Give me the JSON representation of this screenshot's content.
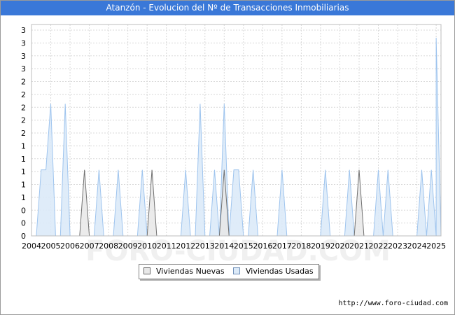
{
  "title": "Atanzón - Evolucion del Nº de Transacciones Inmobiliarias",
  "footer": "http://www.foro-ciudad.com",
  "watermark": "FORO-CIUDAD.COM",
  "colors": {
    "title_bg": "#3a78d8",
    "nuevas_fill": "#e8e8e8",
    "nuevas_line": "#707070",
    "usadas_fill": "#dceaf8",
    "usadas_line": "#9ec4ee",
    "grid": "#d8d8d8"
  },
  "chart_data": {
    "type": "area",
    "title": "Atanzón - Evolucion del Nº de Transacciones Inmobiliarias",
    "xlabel": "",
    "ylabel": "",
    "x_ticks": [
      "2004",
      "2005",
      "2006",
      "2007",
      "2008",
      "2009",
      "2010",
      "2011",
      "2012",
      "2013",
      "2014",
      "2015",
      "2016",
      "2017",
      "2018",
      "2019",
      "2020",
      "2021",
      "2022",
      "2023",
      "2024",
      "2025"
    ],
    "y_ticks": [
      "0",
      "0",
      "0",
      "1",
      "1",
      "1",
      "1",
      "1",
      "2",
      "2",
      "2",
      "2",
      "2",
      "3",
      "3",
      "3",
      "3"
    ],
    "ylim": [
      0,
      3.2
    ],
    "xlim": [
      2004,
      2025.25
    ],
    "grid": true,
    "legend_position": "bottom",
    "series": [
      {
        "name": "Viviendas Nuevas",
        "points": [
          [
            2006.5,
            0
          ],
          [
            2006.75,
            1
          ],
          [
            2007,
            0
          ],
          [
            2010,
            0
          ],
          [
            2010.25,
            1
          ],
          [
            2010.5,
            0
          ],
          [
            2013.75,
            0
          ],
          [
            2014,
            1
          ],
          [
            2014.25,
            0
          ],
          [
            2020.75,
            0
          ],
          [
            2021,
            1
          ],
          [
            2021.25,
            0
          ]
        ]
      },
      {
        "name": "Viviendas Usadas",
        "points": [
          [
            2004.25,
            0
          ],
          [
            2004.5,
            1
          ],
          [
            2004.75,
            1
          ],
          [
            2005,
            2
          ],
          [
            2005.25,
            0
          ],
          [
            2005.5,
            0
          ],
          [
            2005.75,
            2
          ],
          [
            2006,
            0
          ],
          [
            2007.25,
            0
          ],
          [
            2007.5,
            1
          ],
          [
            2007.75,
            0
          ],
          [
            2008.25,
            0
          ],
          [
            2008.5,
            1
          ],
          [
            2008.75,
            0
          ],
          [
            2009.5,
            0
          ],
          [
            2009.75,
            1
          ],
          [
            2010,
            0
          ],
          [
            2011.75,
            0
          ],
          [
            2012,
            1
          ],
          [
            2012.25,
            0
          ],
          [
            2012.5,
            0
          ],
          [
            2012.75,
            2
          ],
          [
            2013,
            0
          ],
          [
            2013.25,
            0
          ],
          [
            2013.5,
            1
          ],
          [
            2013.75,
            0
          ],
          [
            2014,
            2
          ],
          [
            2014.25,
            0
          ],
          [
            2014.5,
            1
          ],
          [
            2014.75,
            1
          ],
          [
            2015,
            0
          ],
          [
            2015.25,
            0
          ],
          [
            2015.5,
            1
          ],
          [
            2015.75,
            0
          ],
          [
            2016.75,
            0
          ],
          [
            2017,
            1
          ],
          [
            2017.25,
            0
          ],
          [
            2019,
            0
          ],
          [
            2019.25,
            1
          ],
          [
            2019.5,
            0
          ],
          [
            2020.25,
            0
          ],
          [
            2020.5,
            1
          ],
          [
            2020.75,
            0
          ],
          [
            2021.75,
            0
          ],
          [
            2022,
            1
          ],
          [
            2022.25,
            0
          ],
          [
            2022.5,
            1
          ],
          [
            2022.75,
            0
          ],
          [
            2024,
            0
          ],
          [
            2024.25,
            1
          ],
          [
            2024.5,
            0
          ],
          [
            2024.75,
            1
          ],
          [
            2025,
            0
          ],
          [
            2025,
            3
          ],
          [
            2025.25,
            0
          ]
        ]
      }
    ]
  },
  "legend": {
    "items": [
      {
        "label": "Viviendas Nuevas"
      },
      {
        "label": "Viviendas Usadas"
      }
    ]
  }
}
